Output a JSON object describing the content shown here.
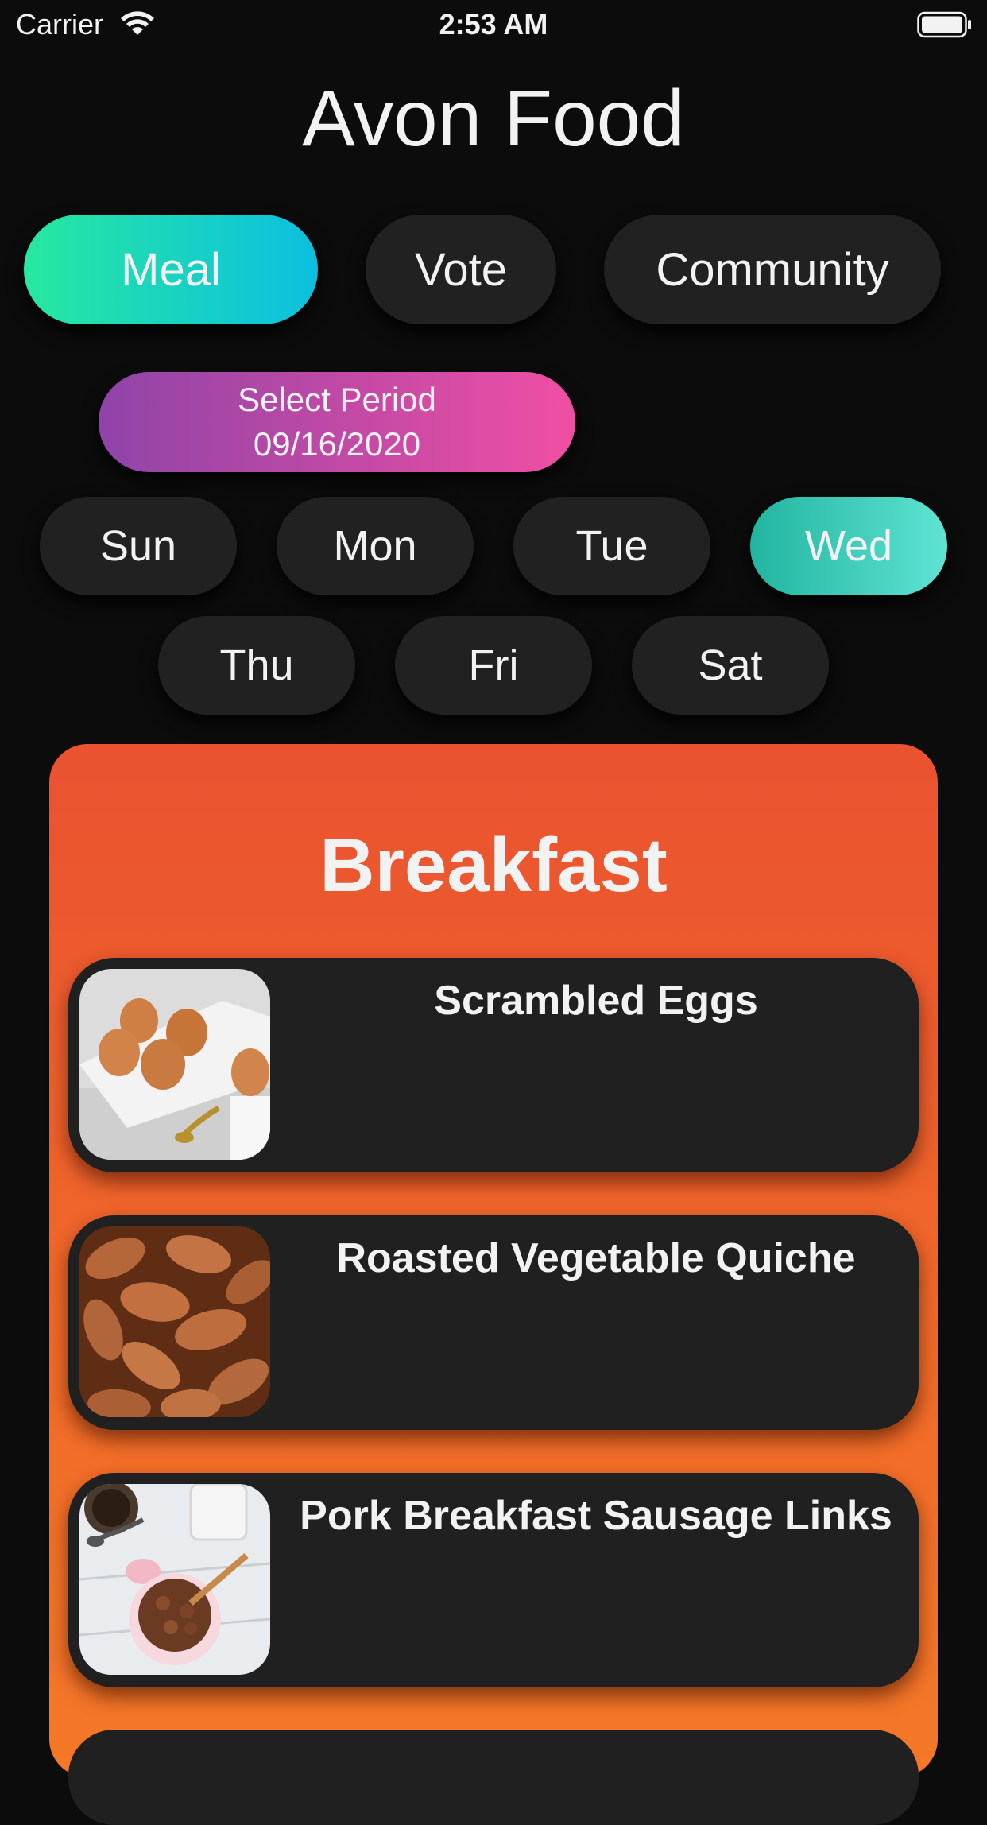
{
  "status": {
    "carrier": "Carrier",
    "time": "2:53 AM"
  },
  "app": {
    "title": "Avon Food"
  },
  "tabs": [
    {
      "label": "Meal",
      "active": true
    },
    {
      "label": "Vote",
      "active": false
    },
    {
      "label": "Community",
      "active": false
    }
  ],
  "period": {
    "label": "Select Period",
    "date": "09/16/2020"
  },
  "days": [
    {
      "label": "Sun",
      "active": false
    },
    {
      "label": "Mon",
      "active": false
    },
    {
      "label": "Tue",
      "active": false
    },
    {
      "label": "Wed",
      "active": true
    },
    {
      "label": "Thu",
      "active": false
    },
    {
      "label": "Fri",
      "active": false
    },
    {
      "label": "Sat",
      "active": false
    }
  ],
  "meal": {
    "title": "Breakfast",
    "items": [
      {
        "name": "Scrambled Eggs",
        "image": "eggs-photo"
      },
      {
        "name": "Roasted Vegetable Quiche",
        "image": "almonds-photo"
      },
      {
        "name": "Pork Breakfast Sausage Links",
        "image": "cereal-bowl-photo"
      }
    ]
  },
  "colors": {
    "background": "#0c0c0c",
    "pill": "#212121",
    "meal_tab_gradient": [
      "#27e8a0",
      "#0cbfe0"
    ],
    "period_gradient": [
      "#8f44a8",
      "#f04fa3"
    ],
    "active_day_gradient": [
      "#21b5a0",
      "#5fe3d3"
    ],
    "card_gradient": [
      "#ea5230",
      "#f47828"
    ]
  }
}
